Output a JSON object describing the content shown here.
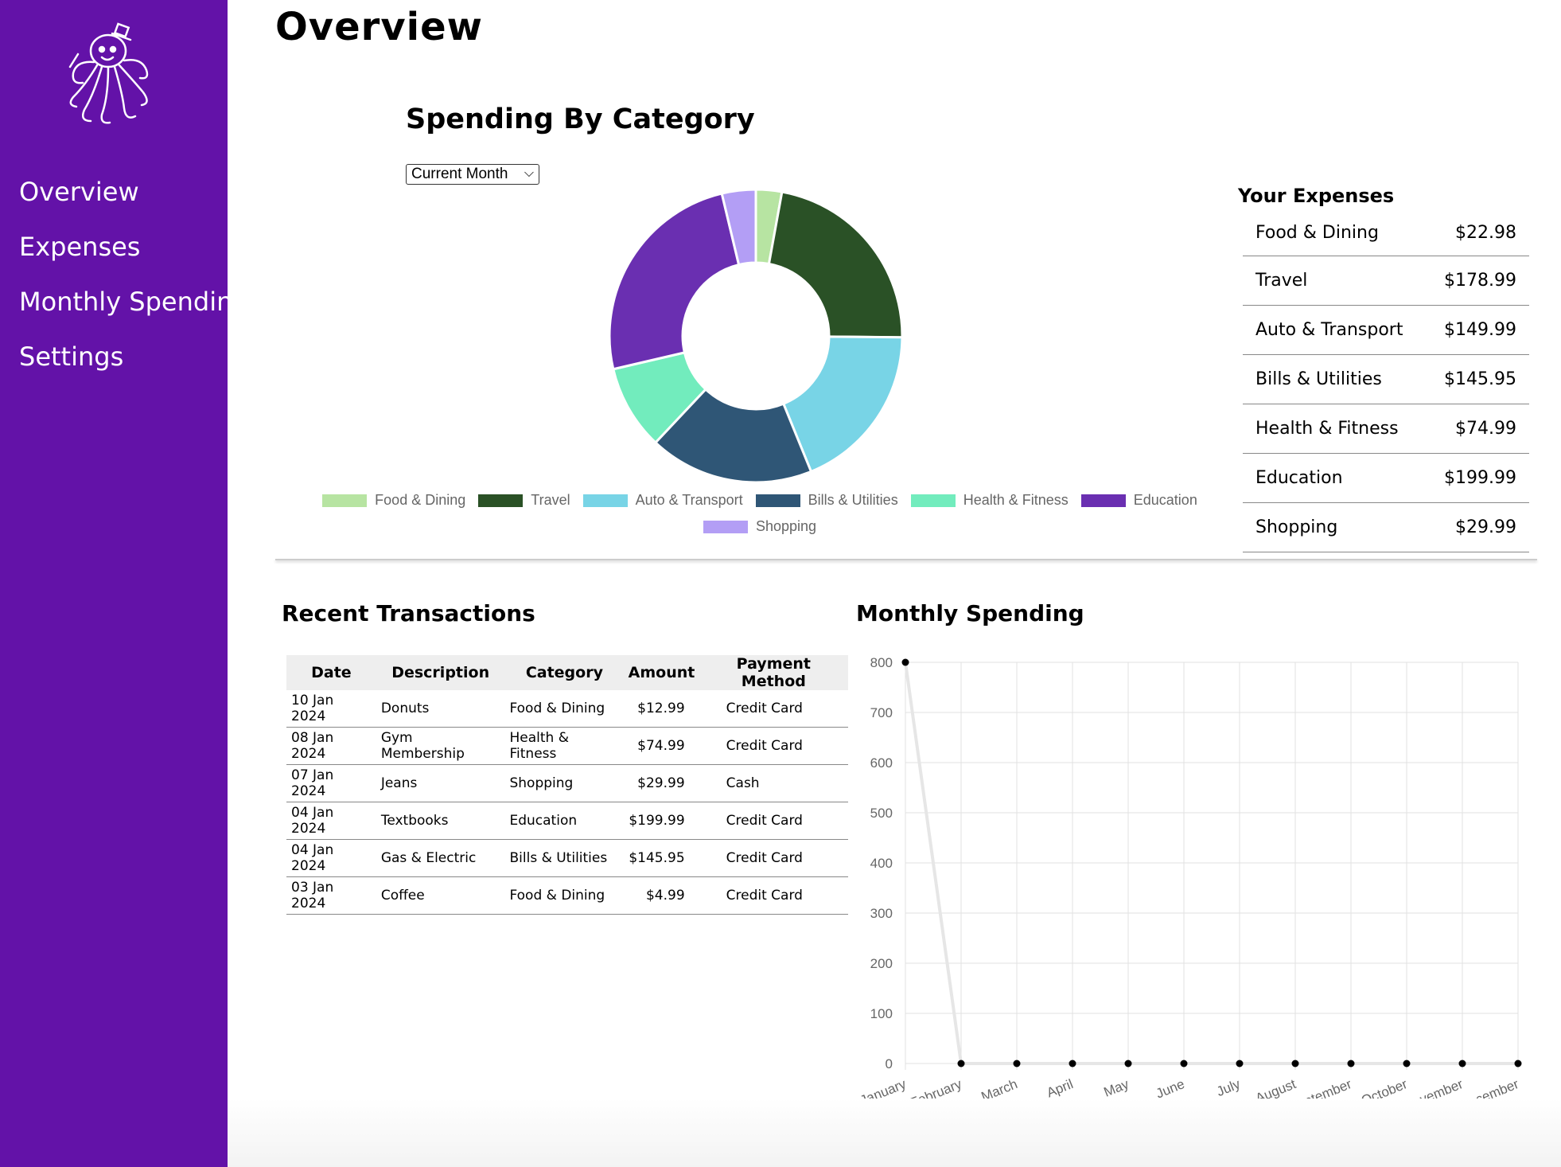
{
  "sidebar": {
    "logo_icon": "octopus-icon",
    "items": [
      {
        "label": "Overview"
      },
      {
        "label": "Expenses"
      },
      {
        "label": "Monthly Spending"
      },
      {
        "label": "Settings"
      }
    ],
    "background": "#6312a8"
  },
  "header": {
    "title": "Overview"
  },
  "spending_by_category": {
    "title": "Spending By Category",
    "period_select": {
      "selected": "Current Month"
    }
  },
  "your_expenses": {
    "title": "Your Expenses",
    "rows": [
      {
        "label": "Food & Dining",
        "amount": "$22.98"
      },
      {
        "label": "Travel",
        "amount": "$178.99"
      },
      {
        "label": "Auto & Transport",
        "amount": "$149.99"
      },
      {
        "label": "Bills & Utilities",
        "amount": "$145.95"
      },
      {
        "label": "Health & Fitness",
        "amount": "$74.99"
      },
      {
        "label": "Education",
        "amount": "$199.99"
      },
      {
        "label": "Shopping",
        "amount": "$29.99"
      }
    ]
  },
  "recent_transactions": {
    "title": "Recent Transactions",
    "columns": [
      "Date",
      "Description",
      "Category",
      "Amount",
      "Payment Method"
    ],
    "rows": [
      [
        "10 Jan 2024",
        "Donuts",
        "Food & Dining",
        "$12.99",
        "Credit Card"
      ],
      [
        "08 Jan 2024",
        "Gym Membership",
        "Health & Fitness",
        "$74.99",
        "Credit Card"
      ],
      [
        "07 Jan 2024",
        "Jeans",
        "Shopping",
        "$29.99",
        "Cash"
      ],
      [
        "04 Jan 2024",
        "Textbooks",
        "Education",
        "$199.99",
        "Credit Card"
      ],
      [
        "04 Jan 2024",
        "Gas & Electric",
        "Bills & Utilities",
        "$145.95",
        "Credit Card"
      ],
      [
        "03 Jan 2024",
        "Coffee",
        "Food & Dining",
        "$4.99",
        "Credit Card"
      ]
    ]
  },
  "monthly_spending": {
    "title": "Monthly Spending"
  },
  "chart_data": [
    {
      "type": "pie",
      "variant": "doughnut",
      "categories": [
        "Food & Dining",
        "Travel",
        "Auto & Transport",
        "Bills & Utilities",
        "Health & Fitness",
        "Education",
        "Shopping"
      ],
      "values": [
        22.98,
        178.99,
        149.99,
        145.95,
        74.99,
        199.99,
        29.99
      ],
      "colors": [
        "#b7e4a2",
        "#2a5126",
        "#78d4e6",
        "#2f5676",
        "#72ecbd",
        "#6a2fb1",
        "#b39ef5"
      ],
      "legend": "bottom"
    },
    {
      "type": "line",
      "x": [
        "January",
        "February",
        "March",
        "April",
        "May",
        "June",
        "July",
        "August",
        "September",
        "October",
        "November",
        "December"
      ],
      "series": [
        {
          "values": [
            800,
            0,
            0,
            0,
            0,
            0,
            0,
            0,
            0,
            0,
            0,
            0
          ]
        }
      ],
      "ylim": [
        0,
        800
      ],
      "yticks": [
        0,
        100,
        200,
        300,
        400,
        500,
        600,
        700,
        800
      ],
      "grid": true,
      "line_color": "#e6e6e6",
      "point_color": "#000000"
    }
  ]
}
